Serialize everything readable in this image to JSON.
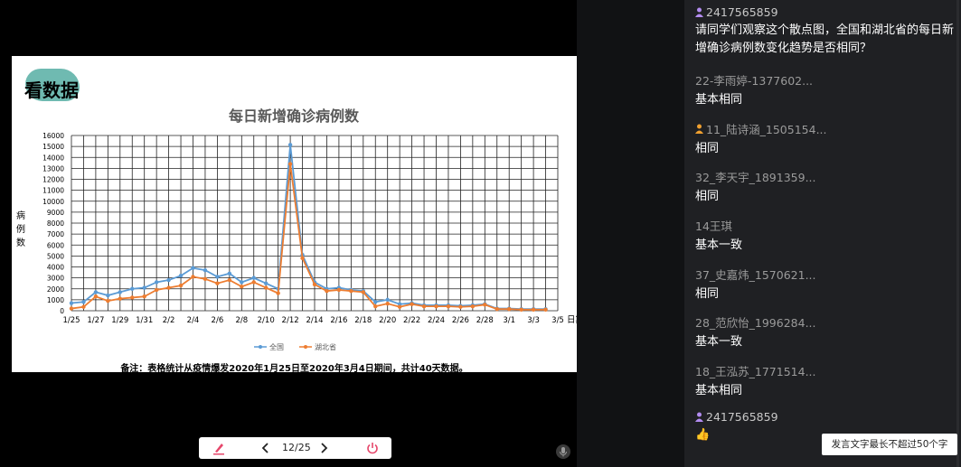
{
  "slide": {
    "logo_text": "看数据",
    "note": "备注：表格统计从疫情爆发2020年1月25日至2020年3月4日期间，共计40天数据。"
  },
  "chart_data": {
    "type": "line",
    "title": "每日新增确诊病例数",
    "xlabel": "日期",
    "ylabel": "病例数",
    "ylim": [
      0,
      16000
    ],
    "yticks": [
      0,
      1000,
      2000,
      3000,
      4000,
      5000,
      6000,
      7000,
      8000,
      9000,
      10000,
      11000,
      12000,
      13000,
      14000,
      15000,
      16000
    ],
    "ytick_labels": [
      "0",
      "1000",
      "2000",
      "3000",
      "4000",
      "5000",
      "6000",
      "7000",
      "8000",
      "9000",
      "10000",
      "11000",
      "12000",
      "13000",
      "14000",
      "15000",
      "16000"
    ],
    "x_count": 41,
    "xtick_labels": [
      "1/25",
      "1/27",
      "1/29",
      "1/31",
      "2/2",
      "2/4",
      "2/6",
      "2/8",
      "2/10",
      "2/12",
      "2/14",
      "2/16",
      "2/18",
      "2/20",
      "2/22",
      "2/24",
      "2/26",
      "2/28",
      "3/1",
      "3/3",
      "3/5"
    ],
    "grid": true,
    "legend": "bottom",
    "series": [
      {
        "name": "全国",
        "color": "#5b9bd5",
        "values": [
          700,
          800,
          1700,
          1400,
          1700,
          2000,
          2100,
          2600,
          2800,
          3200,
          3900,
          3700,
          3100,
          3400,
          2600,
          3000,
          2500,
          2000,
          15150,
          5100,
          2600,
          2000,
          2100,
          1900,
          1800,
          800,
          1000,
          600,
          700,
          500,
          500,
          500,
          450,
          500,
          600,
          200,
          200,
          150,
          150,
          150
        ]
      },
      {
        "name": "湖北省",
        "color": "#ed7d31",
        "values": [
          200,
          350,
          1300,
          900,
          1100,
          1200,
          1300,
          1900,
          2100,
          2300,
          3100,
          2900,
          2500,
          2800,
          2200,
          2600,
          2100,
          1600,
          13400,
          4800,
          2400,
          1800,
          1900,
          1800,
          1700,
          400,
          650,
          350,
          600,
          400,
          400,
          400,
          350,
          400,
          550,
          150,
          150,
          100,
          100,
          100
        ]
      }
    ]
  },
  "toolbar": {
    "pager": "12/25"
  },
  "chat": {
    "messages": [
      {
        "name": "2417565859",
        "text": "请同学们观察这个散点图，全国和湖北省的每日新增确诊病例数变化趋势是否相同？",
        "badge": "teacher",
        "hl": true
      },
      {
        "name": "22-李雨婷-1377602...",
        "text": "基本相同"
      },
      {
        "name": "11_陆诗涵_1505154...",
        "text": "相同",
        "badge": "student"
      },
      {
        "name": "32_李天宇_1891359...",
        "text": "相同"
      },
      {
        "name": "14王琪",
        "text": "基本一致"
      },
      {
        "name": "37_史嘉炜_1570621...",
        "text": "相同"
      },
      {
        "name": "28_范欣怡_1996284...",
        "text": "基本一致"
      },
      {
        "name": "18_王泓苏_1771514...",
        "text": "基本相同"
      },
      {
        "name": "2417565859",
        "text": "👍",
        "badge": "teacher",
        "hl": true
      }
    ],
    "tooltip": "发言文字最长不超过50个字"
  },
  "colors": {
    "teacher_icon": "#b38cf0",
    "student_icon": "#f0a030"
  }
}
